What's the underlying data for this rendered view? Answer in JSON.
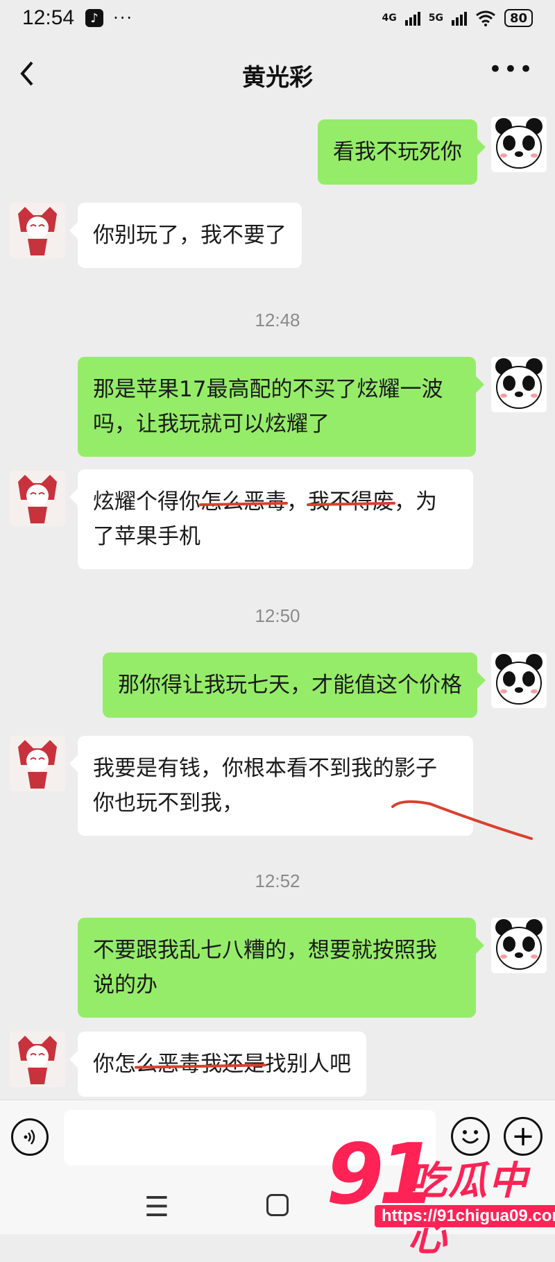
{
  "status_bar": {
    "time": "12:54",
    "network1": "4G",
    "network2": "5G",
    "battery": "80",
    "icons": [
      "tiktok-icon",
      "more-dots-icon",
      "signal-icon",
      "wifi-icon",
      "battery-icon"
    ]
  },
  "header": {
    "title": "黄光彩",
    "back_icon": "chevron-left-icon",
    "more_icon": "more-horizontal-icon"
  },
  "messages": [
    {
      "sender": "me",
      "text": "看我不玩死你"
    },
    {
      "sender": "them",
      "text": "你别玩了，我不要了"
    },
    {
      "type": "timestamp",
      "text": "12:48"
    },
    {
      "sender": "me",
      "line1": "那是苹果17最高配的不买了炫耀一波",
      "line2": "吗，让我玩就可以炫耀了"
    },
    {
      "sender": "them",
      "parts": [
        "炫耀个得你",
        "怎么恶毒",
        "，",
        "我不得废",
        "，为"
      ],
      "line2": "了苹果手机"
    },
    {
      "type": "timestamp",
      "text": "12:50"
    },
    {
      "sender": "me",
      "text": "那你得让我玩七天，才能值这个价格"
    },
    {
      "sender": "them",
      "line1": "我要是有钱，你根本看不到我的影子",
      "line2": "你也玩不到我，"
    },
    {
      "type": "timestamp",
      "text": "12:52"
    },
    {
      "sender": "me",
      "line1": "不要跟我乱七八糟的，想要就按照我",
      "line2": "说的办"
    },
    {
      "sender": "them",
      "parts": [
        "你怎",
        "么恶毒我还是",
        "找别人吧"
      ]
    }
  ],
  "input_bar": {
    "voice_icon": "voice-icon",
    "emoji_icon": "emoji-icon",
    "plus_icon": "plus-circle-icon",
    "plus_glyph": "+"
  },
  "nav_bar": {
    "menu_glyph": "☰",
    "icons": [
      "menu-icon",
      "home-icon"
    ]
  },
  "watermark": {
    "number": "91",
    "text": "吃瓜中心",
    "url": "https://91chigua09.com"
  },
  "colors": {
    "background": "#ededed",
    "my_bubble": "#95ec69",
    "their_bubble": "#ffffff",
    "annotation_red": "#d9402e",
    "watermark": "#ff2255"
  }
}
